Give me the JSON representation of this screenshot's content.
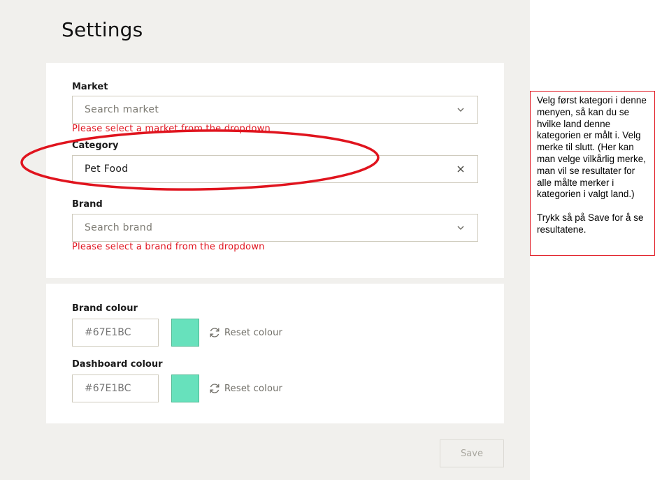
{
  "page": {
    "title": "Settings"
  },
  "market": {
    "label": "Market",
    "placeholder": "Search market",
    "error": "Please select a market from the dropdown",
    "icon": "chevron-down-icon"
  },
  "category": {
    "label": "Category",
    "value": "Pet Food",
    "icon": "clear-icon"
  },
  "brand": {
    "label": "Brand",
    "placeholder": "Search brand",
    "error": "Please select a brand from the dropdown",
    "icon": "chevron-down-icon"
  },
  "brand_colour": {
    "label": "Brand colour",
    "placeholder": "#67E1BC",
    "swatch_color": "#67E1BC",
    "reset_label": "Reset colour",
    "icon": "refresh-icon"
  },
  "dashboard_colour": {
    "label": "Dashboard colour",
    "placeholder": "#67E1BC",
    "swatch_color": "#67E1BC",
    "reset_label": "Reset colour",
    "icon": "refresh-icon"
  },
  "actions": {
    "save_label": "Save"
  },
  "annotation": {
    "ellipse_color": "#E0141E",
    "note_paragraph_1": "Velg først kategori i denne menyen, så kan du se hvilke land denne kategorien er målt i. Velg merke til slutt. (Her kan man velge vilkårlig merke, man vil se resultater for alle målte merker i kategorien i valgt land.)",
    "note_paragraph_2": "Trykk så på Save for å se resultatene."
  },
  "colors": {
    "error": "#E0141E",
    "background": "#F1F0ED",
    "border": "#CFCBBD"
  }
}
